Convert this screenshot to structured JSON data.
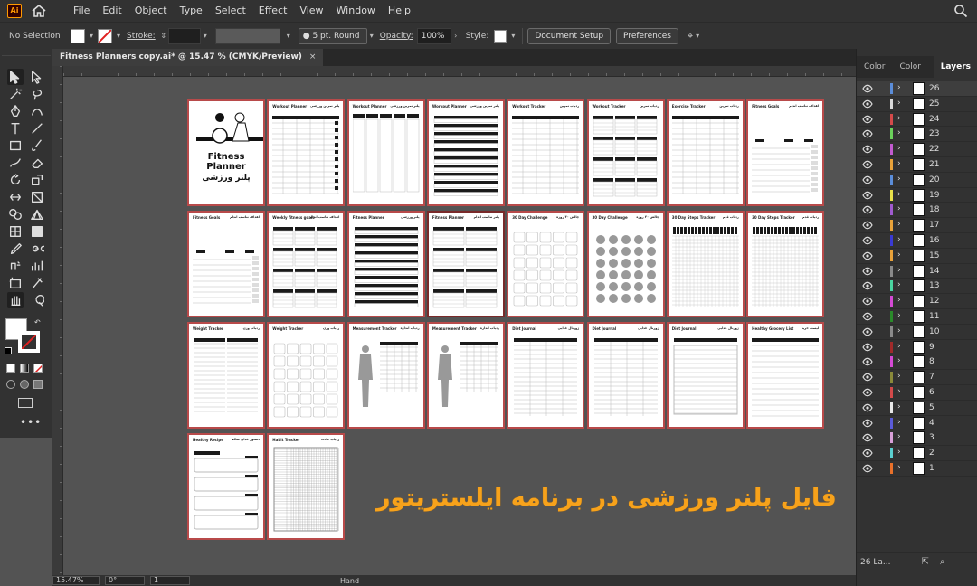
{
  "app": {
    "logo_text": "Ai"
  },
  "menu": [
    "File",
    "Edit",
    "Object",
    "Type",
    "Select",
    "Effect",
    "View",
    "Window",
    "Help"
  ],
  "controlbar": {
    "selection": "No Selection",
    "stroke_label": "Stroke:",
    "brush": "5 pt. Round",
    "opacity_label": "Opacity:",
    "opacity_value": "100%",
    "style_label": "Style:",
    "doc_setup": "Document Setup",
    "preferences": "Preferences"
  },
  "document_tab": {
    "title": "Fitness Planners copy.ai* @ 15.47 % (CMYK/Preview)",
    "close": "×"
  },
  "statusbar": {
    "zoom": "15.47%",
    "rotation": "0°",
    "artboard": "1",
    "tool": "Hand"
  },
  "panel": {
    "tabs": [
      "Color",
      "Color Guide",
      "Layers"
    ],
    "layers": [
      {
        "num": "26",
        "color": "#5b8dd9"
      },
      {
        "num": "25",
        "color": "#d9d9d9"
      },
      {
        "num": "24",
        "color": "#d44a4a"
      },
      {
        "num": "23",
        "color": "#6bd05b"
      },
      {
        "num": "22",
        "color": "#c25bd0"
      },
      {
        "num": "21",
        "color": "#e8a23a"
      },
      {
        "num": "20",
        "color": "#5b8dd9"
      },
      {
        "num": "19",
        "color": "#e8e04a"
      },
      {
        "num": "18",
        "color": "#a05bd0"
      },
      {
        "num": "17",
        "color": "#e8a23a"
      },
      {
        "num": "16",
        "color": "#3a3ad4"
      },
      {
        "num": "15",
        "color": "#e8a23a"
      },
      {
        "num": "14",
        "color": "#8a8a8a"
      },
      {
        "num": "13",
        "color": "#4ad4a0"
      },
      {
        "num": "12",
        "color": "#d44ad4"
      },
      {
        "num": "11",
        "color": "#2a8a2a"
      },
      {
        "num": "10",
        "color": "#8a8a8a"
      },
      {
        "num": "9",
        "color": "#a02a2a"
      },
      {
        "num": "8",
        "color": "#d44ad4"
      },
      {
        "num": "7",
        "color": "#8a8a3a"
      },
      {
        "num": "6",
        "color": "#d44a4a"
      },
      {
        "num": "5",
        "color": "#e8e8e8"
      },
      {
        "num": "4",
        "color": "#5b5bd9"
      },
      {
        "num": "3",
        "color": "#d9a0d9"
      },
      {
        "num": "2",
        "color": "#5bd0d0"
      },
      {
        "num": "1",
        "color": "#e8702a"
      }
    ],
    "footer_count": "26 La..."
  },
  "artboards": [
    {
      "t": "",
      "t2": "",
      "kind": "cover",
      "title": "Fitness Planner",
      "sub": "پلنر ورزشی"
    },
    {
      "t": "Workout Planner",
      "t2": "پلنر تمرین ورزشی",
      "kind": "grid"
    },
    {
      "t": "Workout Planner",
      "t2": "پلنر تمرین ورزشی",
      "kind": "cols"
    },
    {
      "t": "Workout Planner",
      "t2": "پلنر تمرین ورزشی",
      "kind": "bars"
    },
    {
      "t": "Workout Tracker",
      "t2": "ردیاب تمرین",
      "kind": "table"
    },
    {
      "t": "Workout Tracker",
      "t2": "ردیاب تمرین",
      "kind": "blocks"
    },
    {
      "t": "Exercise Tracker",
      "t2": "ردیاب تمرین",
      "kind": "table"
    },
    {
      "t": "Fitness Goals",
      "t2": "اهداف تناسب اندام",
      "kind": "goals"
    },
    {
      "t": "Fitness Goals",
      "t2": "اهداف تناسب اندام",
      "kind": "goals2"
    },
    {
      "t": "Weekly fitness goals",
      "t2": "اهداف تناسب اندام",
      "kind": "blocks"
    },
    {
      "t": "Fitness Planner",
      "t2": "پلنر ورزشی",
      "kind": "bars"
    },
    {
      "t": "Fitness Planner",
      "t2": "پلنر تناسب اندام",
      "kind": "blocks2"
    },
    {
      "t": "30 Day Challenge",
      "t2": "چالش ۳۰ روزه",
      "kind": "days"
    },
    {
      "t": "30 Day Challenge",
      "t2": "چالش ۳۰ روزه",
      "kind": "circles"
    },
    {
      "t": "30 Day Steps Tracker",
      "t2": "ردیاب قدم",
      "kind": "steps"
    },
    {
      "t": "30 Day Steps Tracker",
      "t2": "ردیاب قدم",
      "kind": "steps2"
    },
    {
      "t": "Weight Tracker",
      "t2": "ردیاب وزن",
      "kind": "weight"
    },
    {
      "t": "Weight Tracker",
      "t2": "ردیاب وزن",
      "kind": "days"
    },
    {
      "t": "Measurement Tracker",
      "t2": "ردیاب اندازه",
      "kind": "body"
    },
    {
      "t": "Measurement Tracker",
      "t2": "ردیاب اندازه",
      "kind": "body2"
    },
    {
      "t": "Diet Journal",
      "t2": "ژورنال غذایی",
      "kind": "diet"
    },
    {
      "t": "Diet Journal",
      "t2": "ژورنال غذایی",
      "kind": "diet2"
    },
    {
      "t": "Diet Journal",
      "t2": "ژورنال غذایی",
      "kind": "diet3"
    },
    {
      "t": "Healthy Grocery List",
      "t2": "لیست خرید",
      "kind": "list"
    },
    {
      "t": "Healthy Recipe",
      "t2": "دستور غذای سالم",
      "kind": "recipe"
    },
    {
      "t": "Habit Tracker",
      "t2": "ردیاب عادت",
      "kind": "habit"
    }
  ],
  "overlay_caption": "فایل پلنر ورزشی در برنامه ایلستریتور"
}
